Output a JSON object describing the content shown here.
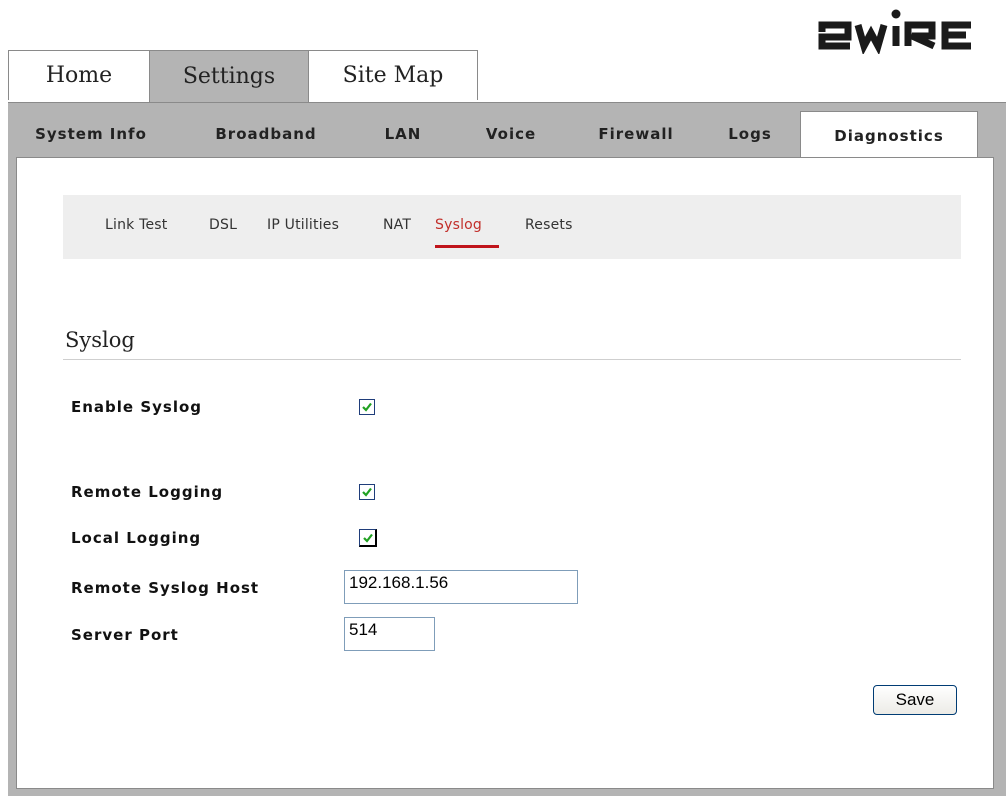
{
  "brand": {
    "logo_text": "2WIRE"
  },
  "main_tabs": [
    {
      "label": "Home",
      "active": false
    },
    {
      "label": "Settings",
      "active": true
    },
    {
      "label": "Site Map",
      "active": false
    }
  ],
  "sub_tabs": [
    {
      "label": "System Info",
      "active": false
    },
    {
      "label": "Broadband",
      "active": false
    },
    {
      "label": "LAN",
      "active": false
    },
    {
      "label": "Voice",
      "active": false
    },
    {
      "label": "Firewall",
      "active": false
    },
    {
      "label": "Logs",
      "active": false
    },
    {
      "label": "Diagnostics",
      "active": true
    }
  ],
  "diagnostics_nav": [
    {
      "label": "Link Test",
      "active": false
    },
    {
      "label": "DSL",
      "active": false
    },
    {
      "label": "IP Utilities",
      "active": false
    },
    {
      "label": "NAT",
      "active": false
    },
    {
      "label": "Syslog",
      "active": true
    },
    {
      "label": "Resets",
      "active": false
    }
  ],
  "section": {
    "title": "Syslog"
  },
  "form": {
    "enable_syslog": {
      "label": "Enable Syslog",
      "checked": true
    },
    "remote_logging": {
      "label": "Remote Logging",
      "checked": true
    },
    "local_logging": {
      "label": "Local Logging",
      "checked": true
    },
    "remote_syslog_host": {
      "label": "Remote Syslog Host",
      "value": "192.168.1.56"
    },
    "server_port": {
      "label": "Server Port",
      "value": "514"
    },
    "save_label": "Save"
  },
  "colors": {
    "frame_grey": "#b4b4b4",
    "active_link": "#c22f2a",
    "checkmark": "#21a121",
    "nav_bg": "#eeeeee"
  }
}
